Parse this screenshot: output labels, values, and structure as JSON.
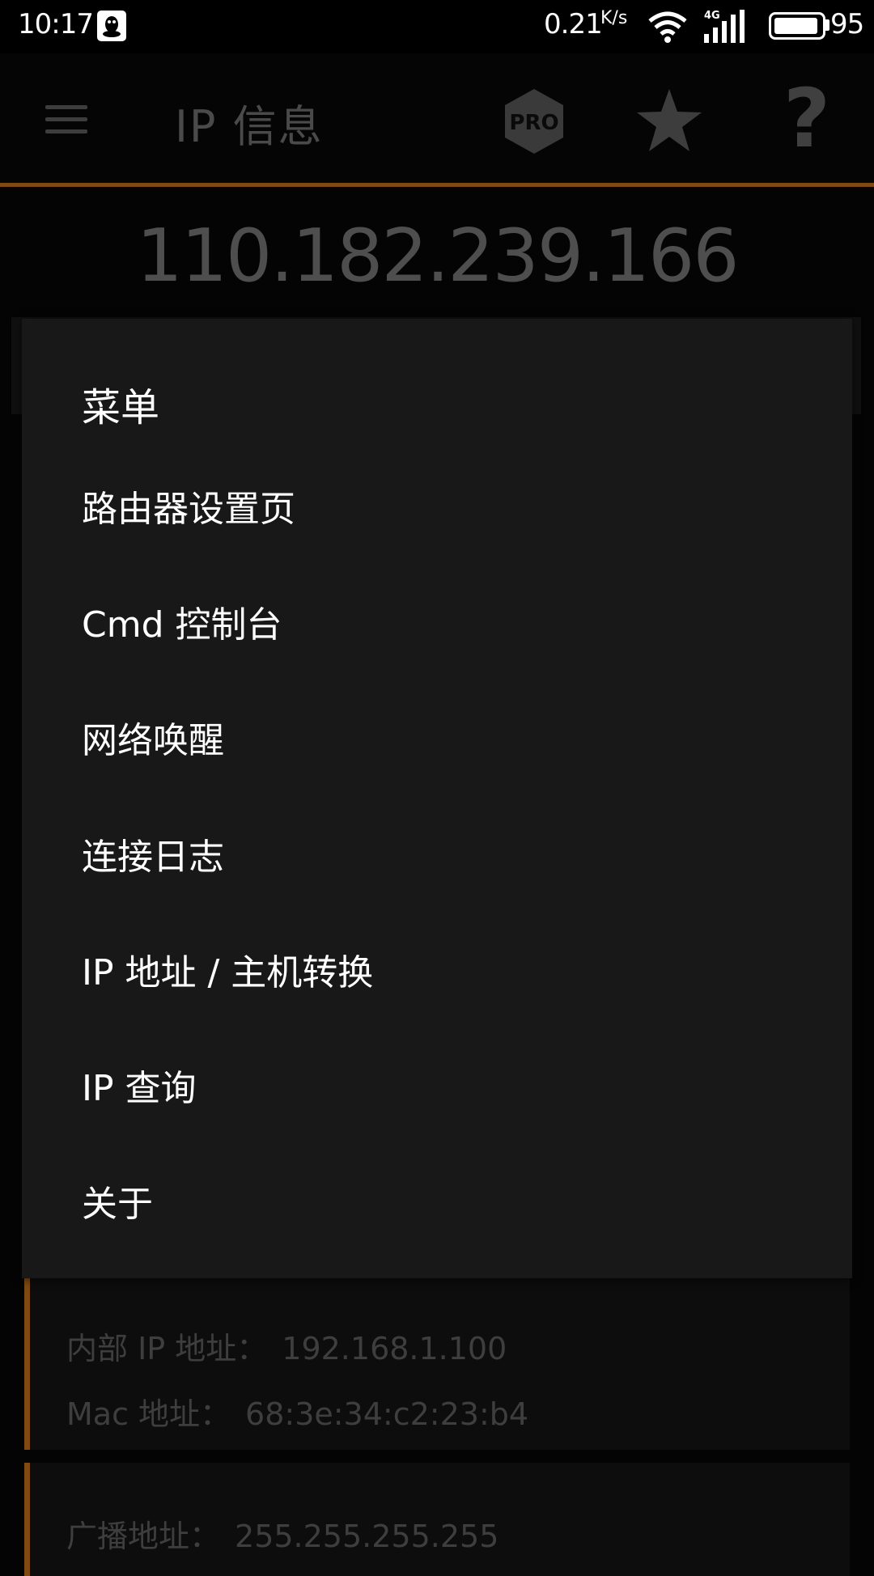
{
  "status_bar": {
    "time": "10:17",
    "network_speed": "0.21",
    "speed_unit": "K/s",
    "network_type": "4G",
    "battery_level": "95"
  },
  "app_bar": {
    "title": "IP 信息",
    "pro_label": "PRO",
    "help_label": "?"
  },
  "ip_address": "110.182.239.166",
  "menu": {
    "title": "菜单",
    "items": [
      {
        "label": "路由器设置页"
      },
      {
        "label": "Cmd 控制台"
      },
      {
        "label": "网络唤醒"
      },
      {
        "label": "连接日志"
      },
      {
        "label": "IP 地址 / 主机转换"
      },
      {
        "label": "IP 查询"
      },
      {
        "label": "关于"
      }
    ]
  },
  "info_cards": [
    {
      "rows": [
        {
          "label": "内部 IP 地址：",
          "value": "192.168.1.100"
        },
        {
          "label": "Mac 地址：",
          "value": "68:3e:34:c2:23:b4"
        }
      ]
    },
    {
      "rows": [
        {
          "label": "广播地址：",
          "value": "255.255.255.255"
        }
      ]
    }
  ],
  "colors": {
    "accent": "#7e4a12",
    "menu_background": "#181818",
    "background": "#040404"
  },
  "icons": {
    "menu": "hamburger-icon",
    "pro": "pro-hexagon-icon",
    "favorite": "star-icon",
    "help": "question-mark-icon",
    "qq": "qq-penguin-icon",
    "wifi": "wifi-icon",
    "signal": "signal-bars-icon",
    "battery": "battery-icon"
  }
}
